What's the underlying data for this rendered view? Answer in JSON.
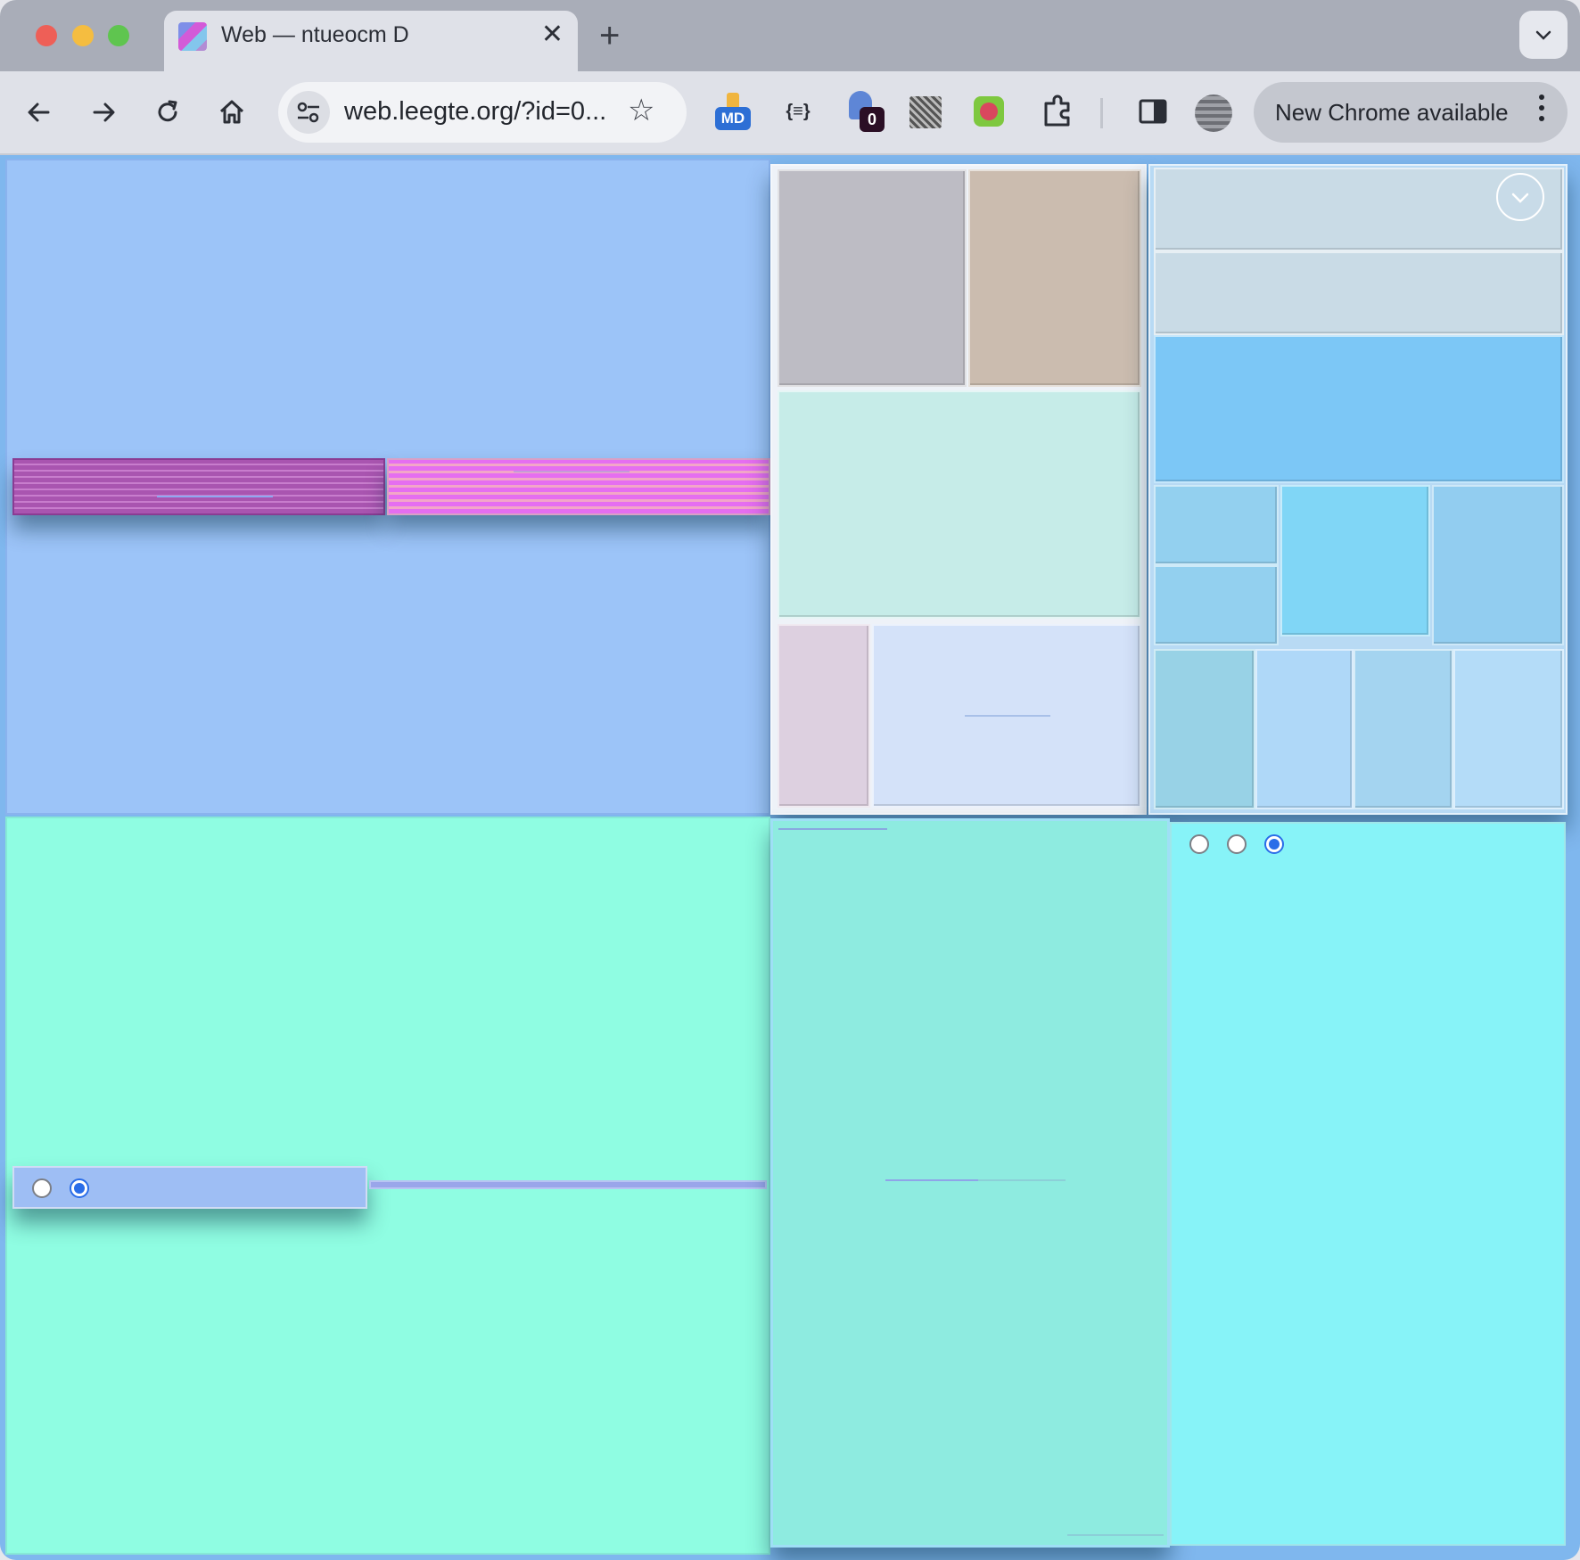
{
  "tab": {
    "title": "Web — ntueocm D",
    "close": "✕"
  },
  "newtab": "+",
  "omnibox": {
    "url": "web.leegte.org/?id=0..."
  },
  "extensions": {
    "md_label": "MD",
    "json_label": "{≡}",
    "ghost_badge": "0"
  },
  "update": {
    "label": "New Chrome available"
  },
  "colors": {
    "top_left_panel": "#9cc4f8",
    "bottom_left_panel": "#8ffde2",
    "bottom_right_panel": "#87f3f8",
    "tall_panel": "#8eebe0",
    "purple_bar": "#a955b0",
    "magenta_bar": "#e56ef0",
    "radio_accent": "#2a6de8"
  },
  "radios_top": [
    false,
    false,
    true
  ],
  "radios_bottom": [
    false,
    true
  ]
}
